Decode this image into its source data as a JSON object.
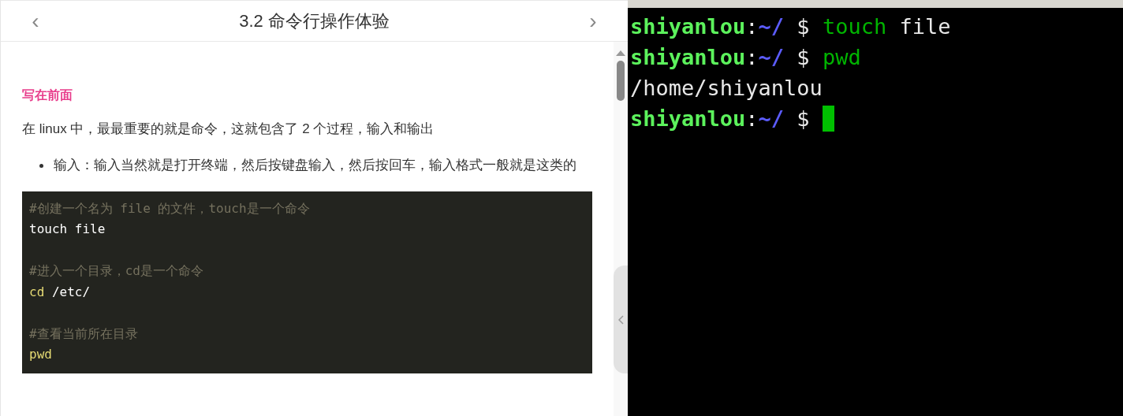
{
  "header": {
    "prev": "‹",
    "title": "3.2 命令行操作体验",
    "next": "›"
  },
  "article": {
    "heading": "写在前面",
    "paragraph": "在 linux 中，最最重要的就是命令，这就包含了 2 个过程，输入和输出",
    "bullets": [
      "输入：输入当然就是打开终端，然后按键盘输入，然后按回车，输入格式一般就是这类的"
    ],
    "code": [
      {
        "kind": "line",
        "segments": [
          {
            "kind": "comment",
            "text": "#创建一个名为 file 的文件，touch是一个命令"
          }
        ]
      },
      {
        "kind": "line",
        "segments": [
          {
            "kind": "plain",
            "text": "touch file"
          }
        ]
      },
      {
        "kind": "blank"
      },
      {
        "kind": "line",
        "segments": [
          {
            "kind": "comment",
            "text": "#进入一个目录，cd是一个命令"
          }
        ]
      },
      {
        "kind": "line",
        "segments": [
          {
            "kind": "keyword",
            "text": "cd"
          },
          {
            "kind": "plain",
            "text": " /etc/"
          }
        ]
      },
      {
        "kind": "blank"
      },
      {
        "kind": "line",
        "segments": [
          {
            "kind": "comment",
            "text": "#查看当前所在目录"
          }
        ]
      },
      {
        "kind": "line",
        "segments": [
          {
            "kind": "keyword",
            "text": "pwd"
          }
        ]
      }
    ]
  },
  "terminal": {
    "lines": [
      [
        {
          "kind": "user",
          "text": "shiyanlou"
        },
        {
          "kind": "plain",
          "text": ":"
        },
        {
          "kind": "path",
          "text": "~/"
        },
        {
          "kind": "plain",
          "text": " $ "
        },
        {
          "kind": "command",
          "text": "touch"
        },
        {
          "kind": "plain",
          "text": " file"
        }
      ],
      [
        {
          "kind": "user",
          "text": "shiyanlou"
        },
        {
          "kind": "plain",
          "text": ":"
        },
        {
          "kind": "path",
          "text": "~/"
        },
        {
          "kind": "plain",
          "text": " $ "
        },
        {
          "kind": "command",
          "text": "pwd"
        }
      ],
      [
        {
          "kind": "plain",
          "text": "/home/shiyanlou"
        }
      ],
      [
        {
          "kind": "user",
          "text": "shiyanlou"
        },
        {
          "kind": "plain",
          "text": ":"
        },
        {
          "kind": "path",
          "text": "~/"
        },
        {
          "kind": "plain",
          "text": " $ "
        },
        {
          "kind": "cursor"
        }
      ]
    ]
  }
}
